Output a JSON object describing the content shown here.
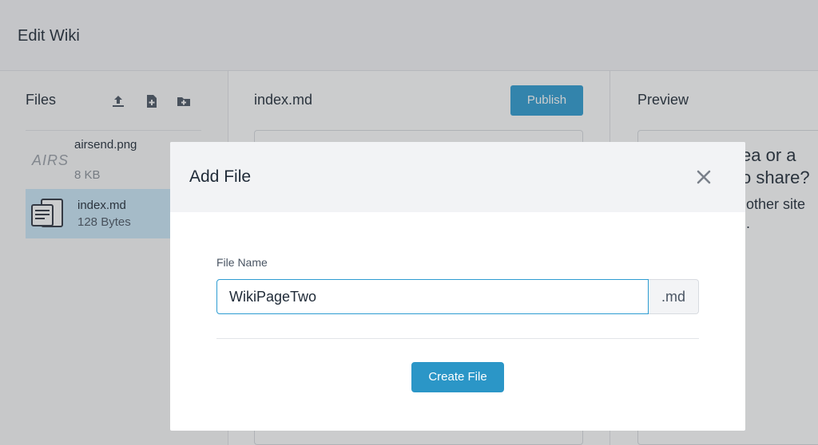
{
  "app": {
    "title": "Edit Wiki"
  },
  "files_panel": {
    "title": "Files",
    "toolbar_icons": [
      "upload-icon",
      "new-file-icon",
      "new-folder-icon"
    ],
    "items": [
      {
        "thumb_text": "AIRS",
        "name": "airsend.png",
        "size": "8 KB",
        "selected": false
      },
      {
        "icon": "document-icon",
        "name": "index.md",
        "size": "128 Bytes",
        "selected": true
      }
    ]
  },
  "editor_panel": {
    "title": "index.md",
    "publish_label": "Publish"
  },
  "preview_panel": {
    "title": "Preview",
    "heading_partial": "ea or a\no share?",
    "text_partial": "other site\n."
  },
  "modal": {
    "title": "Add File",
    "field_label": "File Name",
    "input_value": "WikiPageTwo",
    "suffix": ".md",
    "submit_label": "Create File"
  },
  "colors": {
    "accent": "#2b96c7",
    "selected_row": "#cbe8f8",
    "header_bg": "#f2f3f5"
  }
}
